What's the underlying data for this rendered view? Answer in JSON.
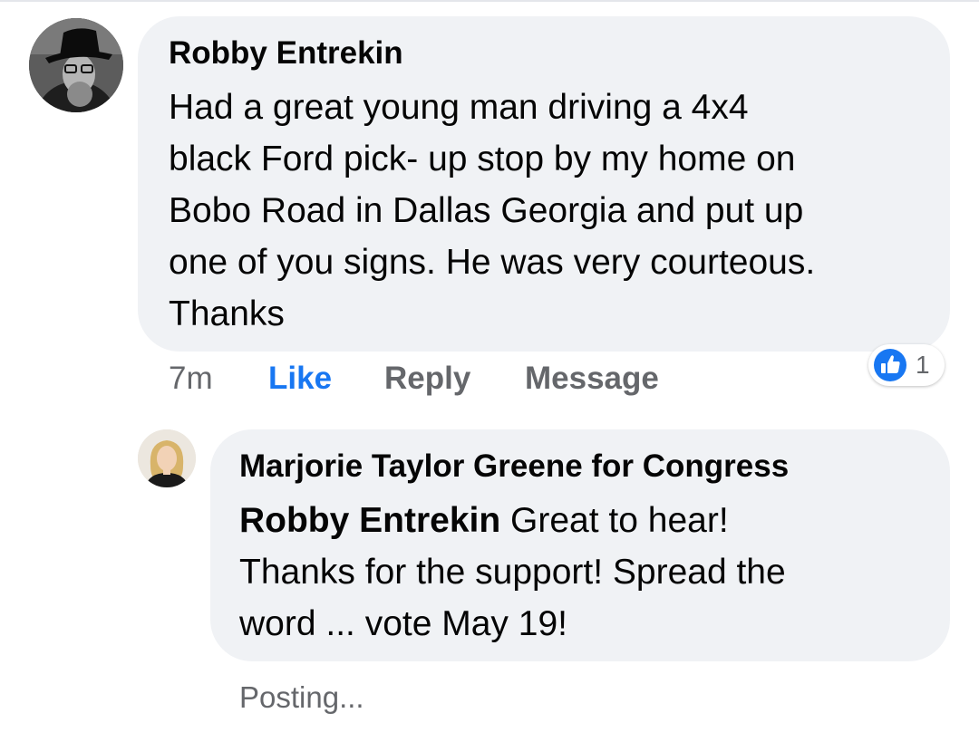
{
  "colors": {
    "bubble_bg": "#f0f2f5",
    "text_primary": "#050505",
    "text_secondary": "#65676b",
    "like_blue": "#1877f2"
  },
  "comment": {
    "author": "Robby Entrekin",
    "text": "Had a great young man driving a 4x4\nblack Ford pick- up stop by my home on\nBobo Road in Dallas Georgia and put up\none of you signs. He was very courteous.\nThanks",
    "avatar_icon": "user-avatar-photo",
    "time": "7m",
    "like_label": "Like",
    "reply_label": "Reply",
    "message_label": "Message",
    "reaction": {
      "icon": "thumbs-up-icon",
      "count": "1"
    }
  },
  "reply": {
    "author": "Marjorie Taylor Greene for Congress",
    "mention": "Robby Entrekin",
    "text": " Great to hear!\nThanks for the support! Spread the\nword ... vote May 19!",
    "avatar_icon": "page-avatar-photo",
    "status": "Posting..."
  }
}
